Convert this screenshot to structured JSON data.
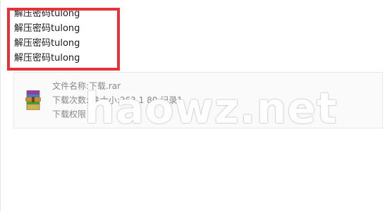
{
  "post": {
    "password_lines": [
      "解压密码tulong",
      "解压密码tulong",
      "解压密码tulong",
      "解压密码tulong"
    ]
  },
  "attachment": {
    "filename_line": "文件名称:下载.rar",
    "download_count_line": "下载次数: 件大小:263 1 80 记录1",
    "permission_label": "下载权限",
    "file_icon": "winrar-archive-icon"
  },
  "watermark": {
    "text": "haowz.net"
  },
  "colors": {
    "highlight_border": "#e5323b",
    "card_background": "#fafafa",
    "muted_text": "#888888",
    "body_text": "#1a1a1a"
  }
}
